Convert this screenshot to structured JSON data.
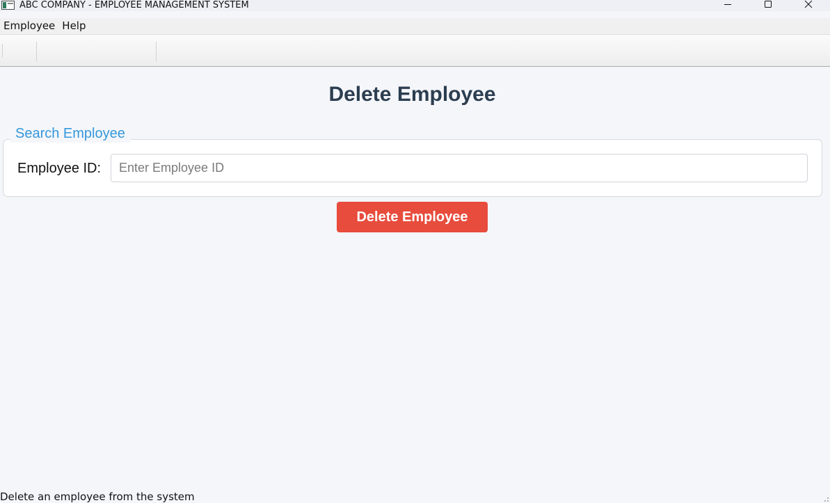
{
  "window": {
    "title": "ABC COMPANY - EMPLOYEE MANAGEMENT SYSTEM",
    "icon": "app-window-icon"
  },
  "window_controls": {
    "minimize_icon": "minimize-icon",
    "maximize_icon": "maximize-icon",
    "close_icon": "close-icon"
  },
  "menubar": {
    "items": [
      {
        "label": "Employee"
      },
      {
        "label": "Help"
      }
    ]
  },
  "main": {
    "title": "Delete Employee",
    "search_group": {
      "legend": "Search Employee",
      "employee_id_label": "Employee ID:",
      "employee_id_value": "",
      "employee_id_placeholder": "Enter Employee ID"
    },
    "delete_button_label": "Delete Employee"
  },
  "statusbar": {
    "text": "Delete an employee from the system"
  },
  "colors": {
    "title": "#2c3e50",
    "legend": "#3498db",
    "danger": "#e74c3c",
    "background": "#f5f6fa"
  }
}
